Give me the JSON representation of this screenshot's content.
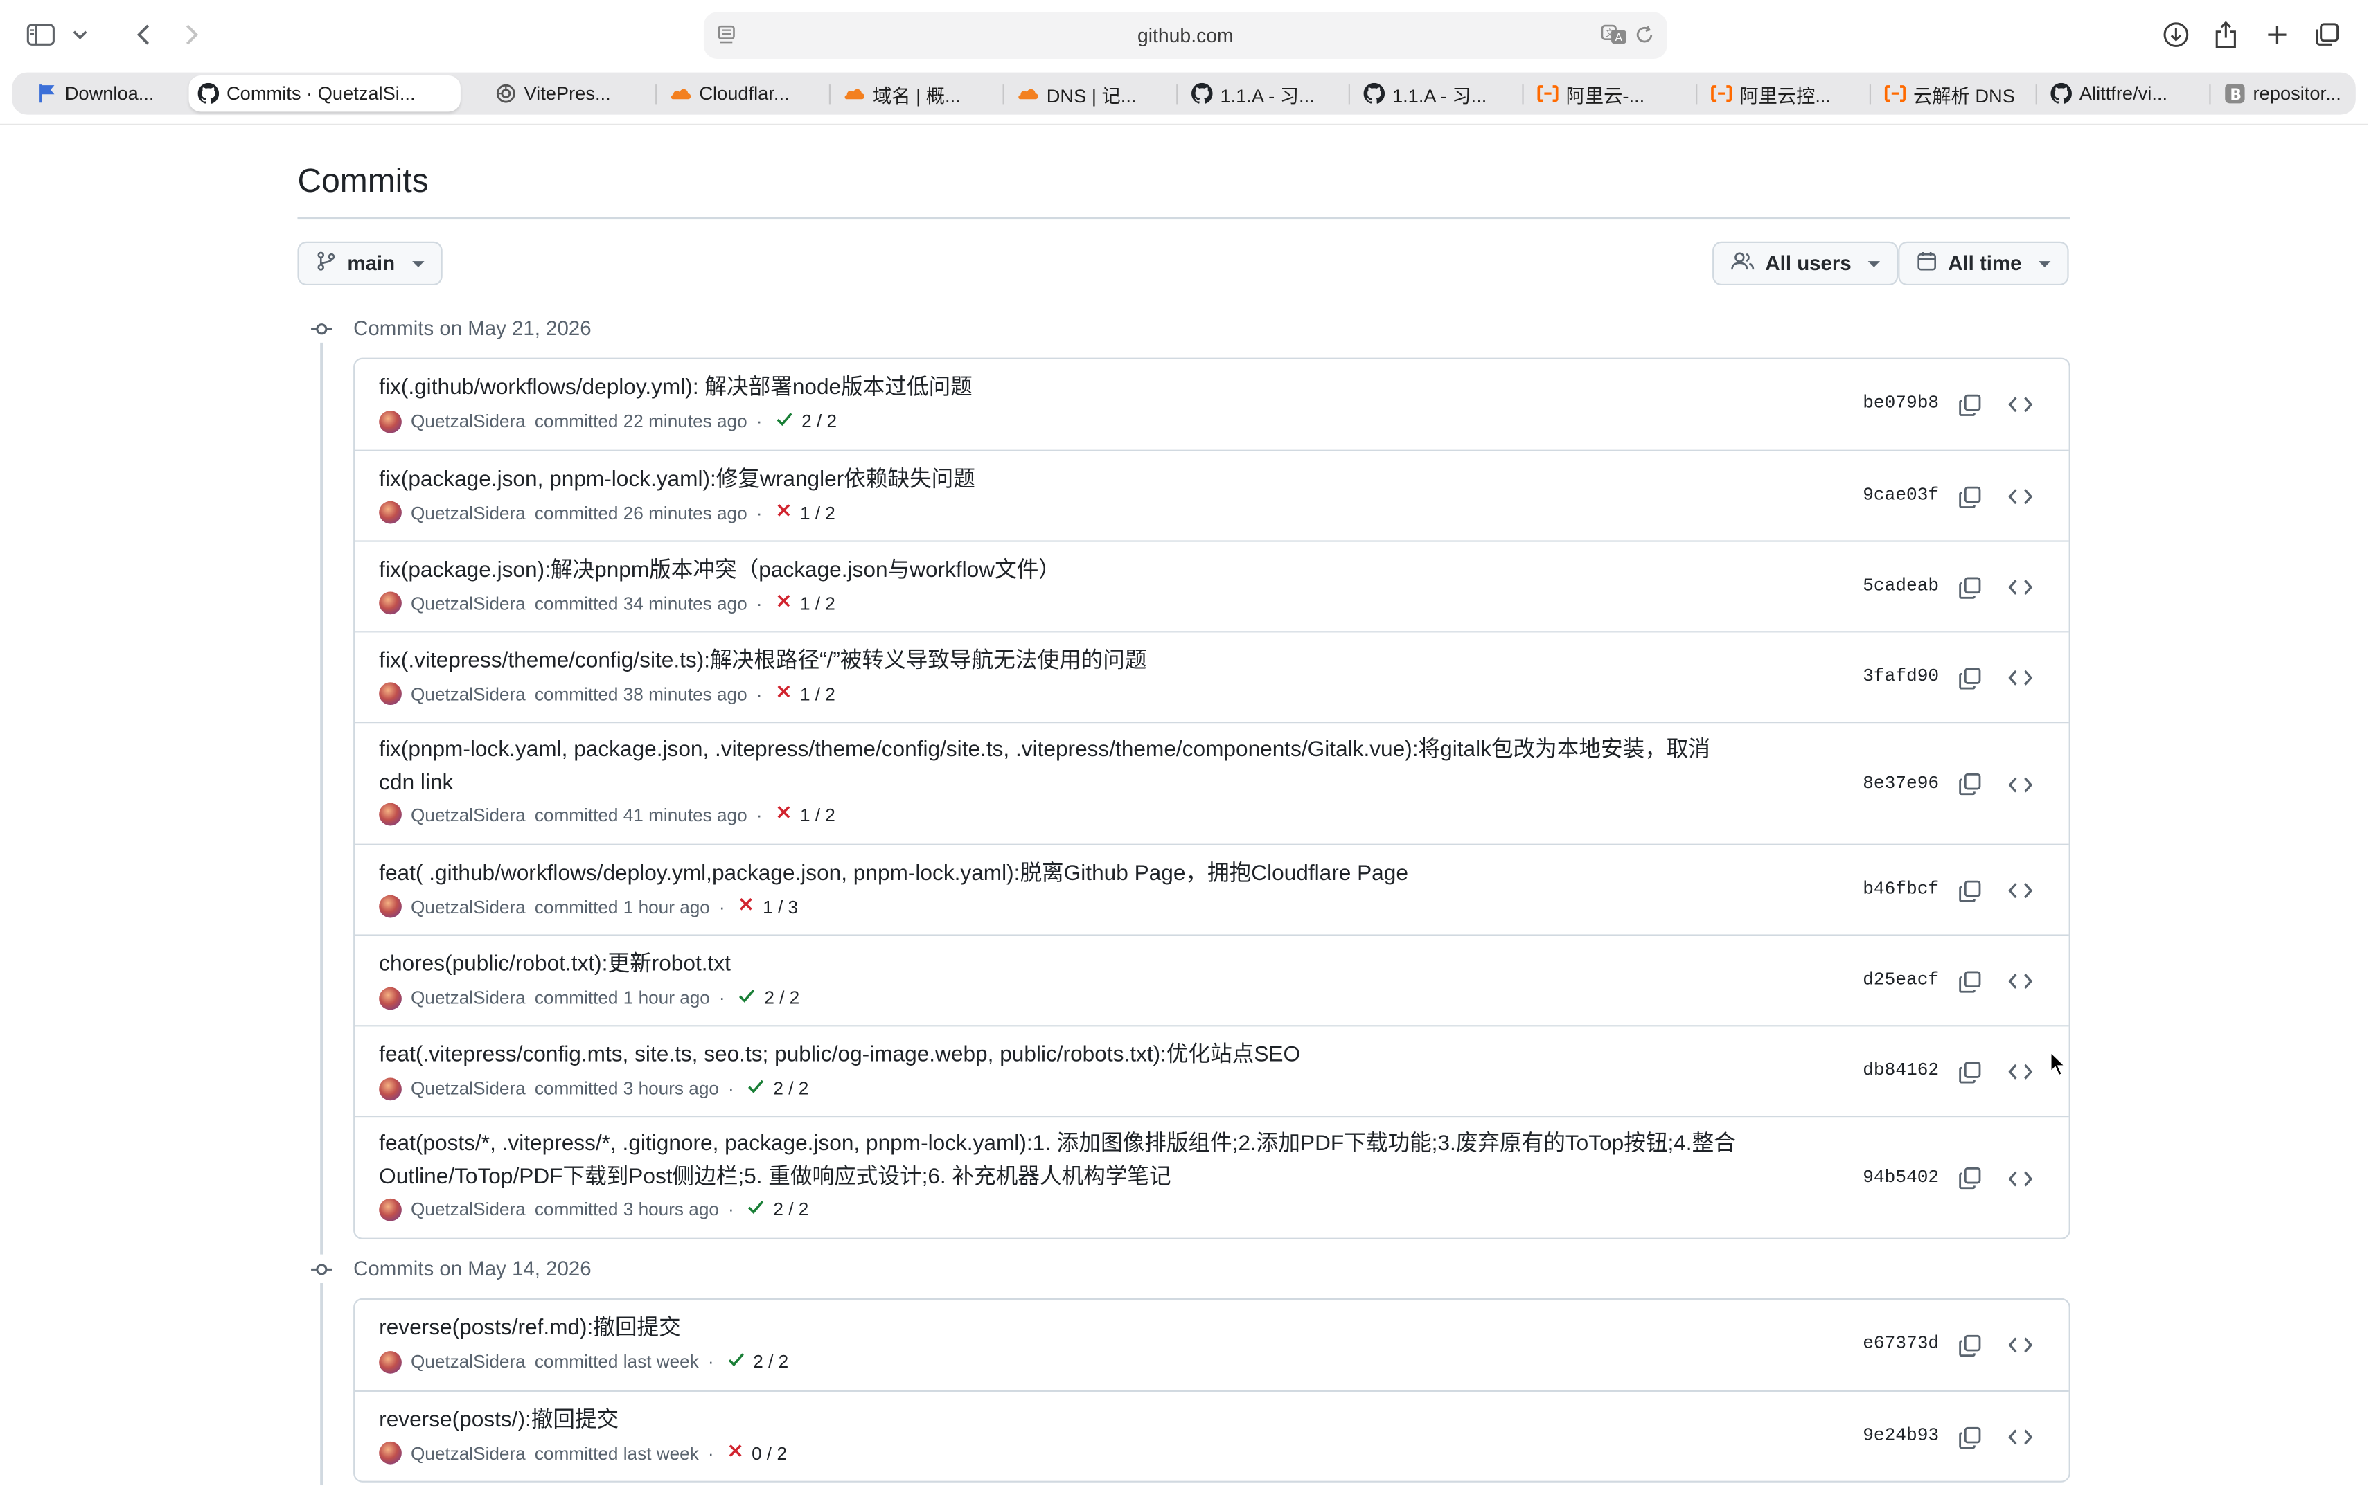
{
  "browser": {
    "url": "github.com",
    "tabs": [
      {
        "label": "Downloa...",
        "icon": "flag-icon",
        "color": "#3b6fd8"
      },
      {
        "label": "Commits · QuetzalSi...",
        "icon": "github-icon",
        "color": "#1f2328",
        "active": true
      },
      {
        "label": "VitePres...",
        "icon": "vitepress-icon",
        "color": "#555555"
      },
      {
        "label": "Cloudflar...",
        "icon": "cloudflare-icon",
        "color": "#f38020"
      },
      {
        "label": "域名 | 概...",
        "icon": "cloudflare-icon",
        "color": "#f38020"
      },
      {
        "label": "DNS | 记...",
        "icon": "cloudflare-icon",
        "color": "#f38020"
      },
      {
        "label": "1.1.A - 习...",
        "icon": "github-icon",
        "color": "#1f2328"
      },
      {
        "label": "1.1.A - 习...",
        "icon": "github-icon",
        "color": "#1f2328"
      },
      {
        "label": "阿里云-...",
        "icon": "aliyun-icon",
        "color": "#ff6a00"
      },
      {
        "label": "阿里云控...",
        "icon": "aliyun-icon",
        "color": "#ff6a00"
      },
      {
        "label": "云解析 DNS",
        "icon": "aliyun-icon",
        "color": "#ff6a00"
      },
      {
        "label": "Alittfre/vi...",
        "icon": "github-icon",
        "color": "#1f2328"
      },
      {
        "label": "repositor...",
        "icon": "b-icon",
        "color": "#8a8a8a"
      }
    ]
  },
  "page": {
    "title": "Commits",
    "branch": "main",
    "users_filter": "All users",
    "time_filter": "All time"
  },
  "groups": [
    {
      "heading": "Commits on May 21, 2026",
      "commits": [
        {
          "message": "fix(.github/workflows/deploy.yml): 解决部署node版本过低问题",
          "author": "QuetzalSidera",
          "when": "committed 22 minutes ago",
          "status": "pass",
          "checks": "2 / 2",
          "sha": "be079b8"
        },
        {
          "message": "fix(package.json, pnpm-lock.yaml):修复wrangler依赖缺失问题",
          "author": "QuetzalSidera",
          "when": "committed 26 minutes ago",
          "status": "fail",
          "checks": "1 / 2",
          "sha": "9cae03f"
        },
        {
          "message": "fix(package.json):解决pnpm版本冲突（package.json与workflow文件）",
          "author": "QuetzalSidera",
          "when": "committed 34 minutes ago",
          "status": "fail",
          "checks": "1 / 2",
          "sha": "5cadeab"
        },
        {
          "message": "fix(.vitepress/theme/config/site.ts):解决根路径“/”被转义导致导航无法使用的问题",
          "author": "QuetzalSidera",
          "when": "committed 38 minutes ago",
          "status": "fail",
          "checks": "1 / 2",
          "sha": "3fafd90"
        },
        {
          "message": "fix(pnpm-lock.yaml, package.json, .vitepress/theme/config/site.ts, .vitepress/theme/components/Gitalk.vue):将gitalk包改为本地安装，取消cdn link",
          "author": "QuetzalSidera",
          "when": "committed 41 minutes ago",
          "status": "fail",
          "checks": "1 / 2",
          "sha": "8e37e96"
        },
        {
          "message": "feat( .github/workflows/deploy.yml,package.json, pnpm-lock.yaml):脱离Github Page，拥抱Cloudflare Page",
          "author": "QuetzalSidera",
          "when": "committed 1 hour ago",
          "status": "fail",
          "checks": "1 / 3",
          "sha": "b46fbcf"
        },
        {
          "message": "chores(public/robot.txt):更新robot.txt",
          "author": "QuetzalSidera",
          "when": "committed 1 hour ago",
          "status": "pass",
          "checks": "2 / 2",
          "sha": "d25eacf"
        },
        {
          "message": "feat(.vitepress/config.mts, site.ts, seo.ts; public/og-image.webp, public/robots.txt):优化站点SEO",
          "author": "QuetzalSidera",
          "when": "committed 3 hours ago",
          "status": "pass",
          "checks": "2 / 2",
          "sha": "db84162"
        },
        {
          "message": "feat(posts/*, .vitepress/*, .gitignore, package.json, pnpm-lock.yaml):1. 添加图像排版组件;2.添加PDF下载功能;3.废弃原有的ToTop按钮;4.整合Outline/ToTop/PDF下载到Post侧边栏;5. 重做响应式设计;6. 补充机器人机构学笔记",
          "author": "QuetzalSidera",
          "when": "committed 3 hours ago",
          "status": "pass",
          "checks": "2 / 2",
          "sha": "94b5402"
        }
      ]
    },
    {
      "heading": "Commits on May 14, 2026",
      "commits": [
        {
          "message": "reverse(posts/ref.md):撤回提交",
          "author": "QuetzalSidera",
          "when": "committed last week",
          "status": "pass",
          "checks": "2 / 2",
          "sha": "e67373d"
        },
        {
          "message": "reverse(posts/):撤回提交",
          "author": "QuetzalSidera",
          "when": "committed last week",
          "status": "fail",
          "checks": "0 / 2",
          "sha": "9e24b93"
        }
      ]
    }
  ],
  "colors": {
    "pass": "#1a7f37",
    "fail": "#d1242f",
    "border": "#d1d9e0",
    "muted": "#59636e"
  }
}
